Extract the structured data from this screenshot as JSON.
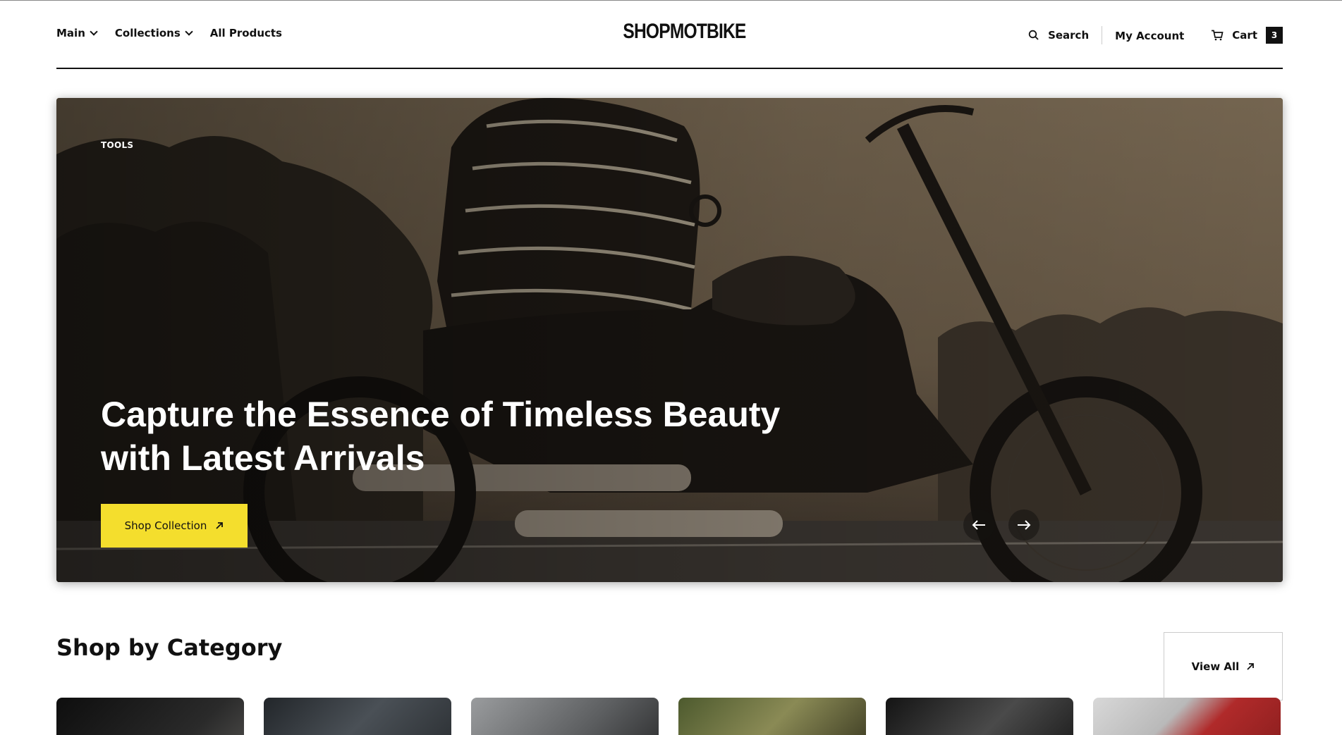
{
  "header": {
    "nav_left": [
      {
        "label": "Main",
        "dropdown": true
      },
      {
        "label": "Collections",
        "dropdown": true
      },
      {
        "label": "All Products",
        "dropdown": false
      }
    ],
    "logo": "SHOPMOTBIKE",
    "search_label": "Search",
    "account_label": "My Account",
    "cart_label": "Cart",
    "cart_count": "3"
  },
  "hero": {
    "tag": "TOOLS",
    "title_line1": "Capture the Essence of Timeless Beauty",
    "title_line2": "with Latest Arrivals",
    "button_label": "Shop Collection",
    "button_icon": "arrow-up-right-icon",
    "prev_icon": "arrow-left-icon",
    "next_icon": "arrow-right-icon",
    "button_color": "#f4de2d"
  },
  "category_section": {
    "title": "Shop by Category",
    "view_all_label": "View All",
    "cards": [
      {
        "image": "dark-rider-photo",
        "tone": "#1b1b1b"
      },
      {
        "image": "engine-photo",
        "tone": "#3a3f44"
      },
      {
        "image": "motorbike-grey-photo",
        "tone": "#8a8c8e"
      },
      {
        "image": "outdoor-bike-photo",
        "tone": "#6b6a3e"
      },
      {
        "image": "black-tank-photo",
        "tone": "#2b2b2b"
      },
      {
        "image": "red-bike-photo",
        "tone": "#b02a2a"
      }
    ]
  }
}
